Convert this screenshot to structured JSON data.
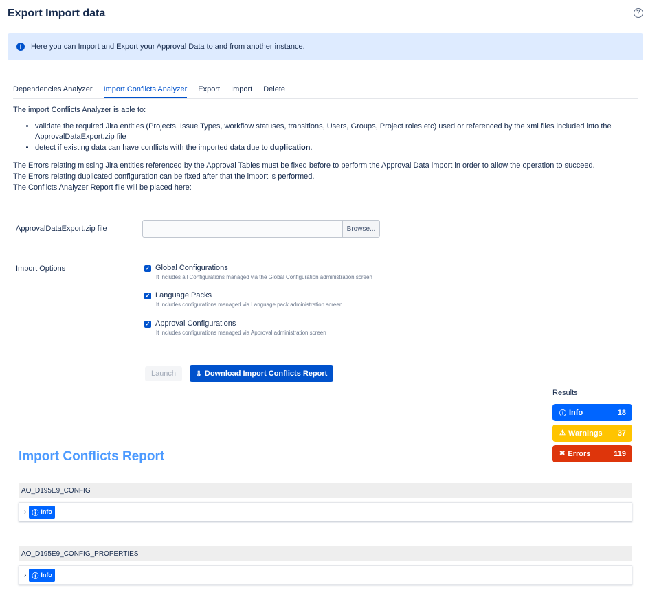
{
  "page": {
    "title": "Export Import data",
    "help_icon": "?"
  },
  "banner": {
    "icon": "i",
    "text": "Here you can Import and Export your Approval Data to and from another instance."
  },
  "tabs": [
    {
      "label": "Dependencies Analyzer"
    },
    {
      "label": "Import Conflicts Analyzer",
      "active": true
    },
    {
      "label": "Export"
    },
    {
      "label": "Import"
    },
    {
      "label": "Delete"
    }
  ],
  "description": {
    "intro": "The import Conflicts Analyzer is able to:",
    "bullet1": "validate the required Jira entities (Projects, Issue Types, workflow statuses, transitions, Users, Groups, Project roles etc) used or referenced by the xml files included into the ApprovalDataExport.zip file",
    "bullet2_prefix": "detect if existing data can have conflicts with the imported data due to ",
    "bullet2_bold": "duplication",
    "bullet2_suffix": ".",
    "line1": "The Errors relating missing Jira entities referenced by the Approval Tables must be fixed before to perform the Approval Data import in order to allow the operation to succeed.",
    "line2": "The Errors relating duplicated configuration can be fixed after that the import is performed.",
    "line3": "The Conflicts Analyzer Report file will be placed here:"
  },
  "form": {
    "file_label": "ApprovalDataExport.zip file",
    "file_value": "",
    "browse_label": "Browse...",
    "options_label": "Import Options",
    "options": [
      {
        "label": "Global Configurations",
        "hint": "It includes all Configurations managed via the Global Configuration administration screen",
        "checked": true
      },
      {
        "label": "Language Packs",
        "hint": "It includes configurations managed via Language pack administration screen",
        "checked": true
      },
      {
        "label": "Approval Configurations",
        "hint": "It includes configurations managed via Approval administration screen",
        "checked": true
      }
    ],
    "launch_label": "Launch",
    "download_label": "Download Import Conflicts Report"
  },
  "results": {
    "title": "Results",
    "items": [
      {
        "label": "Info",
        "count": "18",
        "color": "#0065ff",
        "icon": "info-icon"
      },
      {
        "label": "Warnings",
        "count": "37",
        "color": "#ffc400",
        "icon": "warning-icon"
      },
      {
        "label": "Errors",
        "count": "119",
        "color": "#de350b",
        "icon": "error-icon"
      }
    ]
  },
  "report": {
    "title": "Import Conflicts Report",
    "sections": [
      {
        "name": "AO_D195E9_CONFIG",
        "badge": "Info"
      },
      {
        "name": "AO_D195E9_CONFIG_PROPERTIES",
        "badge": "Info"
      }
    ]
  }
}
